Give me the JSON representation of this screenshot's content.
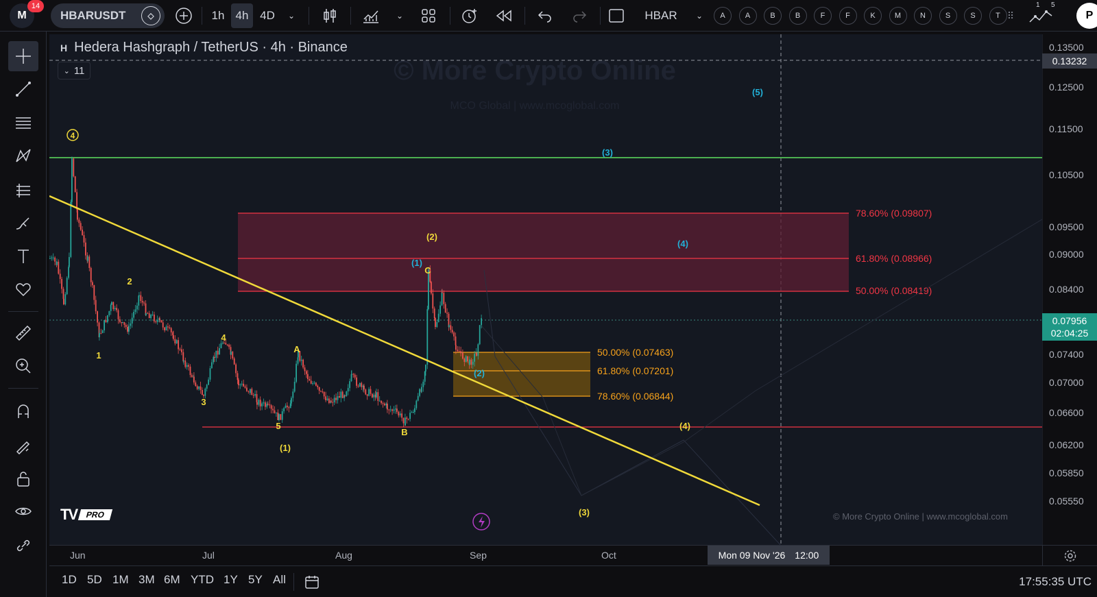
{
  "topbar": {
    "notif_count": "14",
    "symbol": "HBARUSDT",
    "intervals": [
      "1h",
      "4h",
      "4D"
    ],
    "active_interval": "4h",
    "compare_symbol": "HBAR",
    "letter_buttons": [
      "A",
      "A",
      "B",
      "B",
      "F",
      "F",
      "K",
      "M",
      "N",
      "S",
      "S",
      "T"
    ],
    "layout_counts": [
      "1",
      "5"
    ],
    "profile_initial": "P"
  },
  "chart": {
    "title": "Hedera Hashgraph / TetherUS · 4h · Binance",
    "title_icon": "H",
    "indicators_count": "11",
    "watermark_main": "© More Crypto Online",
    "watermark_sub": "MCO Global   |   www.mcoglobal.com",
    "footer_credit": "© More Crypto Online   |   www.mcoglobal.com",
    "pro_badge": "PRO",
    "crosshair_date": "Mon 09 Nov '26",
    "crosshair_time": "12:00",
    "current_price": "0.07956",
    "countdown": "02:04:25",
    "crosshair_price": "0.13232",
    "price_ticks": [
      "0.13500",
      "0.12500",
      "0.11500",
      "0.10500",
      "0.09500",
      "0.09000",
      "0.08400",
      "0.07400",
      "0.07000",
      "0.06600",
      "0.06200",
      "0.05850",
      "0.05550"
    ],
    "time_ticks": [
      "Jun",
      "Jul",
      "Aug",
      "Sep",
      "Oct"
    ],
    "fib_upper": [
      "78.60% (0.09807)",
      "61.80% (0.08966)",
      "50.00% (0.08419)"
    ],
    "fib_lower": [
      "50.00% (0.07463)",
      "61.80% (0.07201)",
      "78.60% (0.06844)"
    ],
    "wave_labels": {
      "w4_circled": "4",
      "w1": "1",
      "w2": "2",
      "w3": "3",
      "w4": "4",
      "w5": "5",
      "wA": "A",
      "wB": "B",
      "wC": "C",
      "p1": "(1)",
      "p2_yellow": "(2)",
      "p3_cyan": "(3)",
      "p4_cyan": "(4)",
      "p5_cyan": "(5)",
      "p1_cyan": "(1)",
      "p2_cyan": "(2)",
      "p4_yellow": "(4)",
      "p3_yellow": "(3)"
    },
    "colors": {
      "green_line": "#4caf50",
      "trend_line": "#f0d93a",
      "fib_red": "#f23645",
      "fib_orange": "#f7a21b",
      "cyan_label": "#22b1d8",
      "yellow_label": "#f0d93a"
    }
  },
  "bottombar": {
    "ranges": [
      "1D",
      "5D",
      "1M",
      "3M",
      "6M",
      "YTD",
      "1Y",
      "5Y",
      "All"
    ],
    "clock": "17:55:35 UTC"
  }
}
